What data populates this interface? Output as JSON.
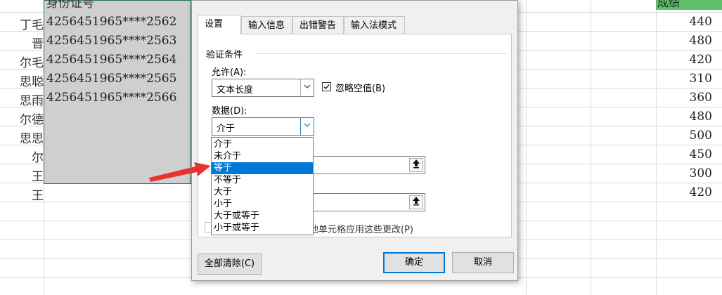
{
  "sheet": {
    "col_a": [
      "丁毛",
      "晋",
      "尔毛",
      "思聪",
      "思雨",
      "尔德",
      "思思",
      "尔",
      "王",
      "王"
    ],
    "ids": [
      "4256451965****2562",
      "4256451965****2563",
      "4256451965****2564",
      "4256451965****2565",
      "4256451965****2566"
    ],
    "header_id": "身份证号",
    "header_score": "成绩",
    "scores": [
      "440",
      "480",
      "420",
      "310",
      "360",
      "480",
      "500",
      "450",
      "300",
      "420"
    ]
  },
  "dialog": {
    "tabs": [
      "设置",
      "输入信息",
      "出错警告",
      "输入法模式"
    ],
    "section_title": "验证条件",
    "allow_label": "允许(A):",
    "allow_value": "文本长度",
    "ignore_blank_label": "忽略空值(B)",
    "ignore_blank_checked": true,
    "data_label": "数据(D):",
    "data_value": "介于",
    "options": [
      "介于",
      "未介于",
      "等于",
      "不等于",
      "大于",
      "小于",
      "大于或等于",
      "小于或等于"
    ],
    "selected_option": "等于",
    "apply_text": "他单元格应用这些更改(P)",
    "clear_all": "全部清除(C)",
    "ok": "确定",
    "cancel": "取消"
  },
  "icons": {
    "dropdown": "chevron-down-icon",
    "range_select": "range-select-icon",
    "check": "checkmark-icon",
    "annotation": "red-arrow-icon"
  },
  "colors": {
    "selection_blue": "#0078d7",
    "annotation_red": "#e8322e",
    "header_green": "#5fbf6b",
    "selected_range": "#cfcfcf"
  }
}
